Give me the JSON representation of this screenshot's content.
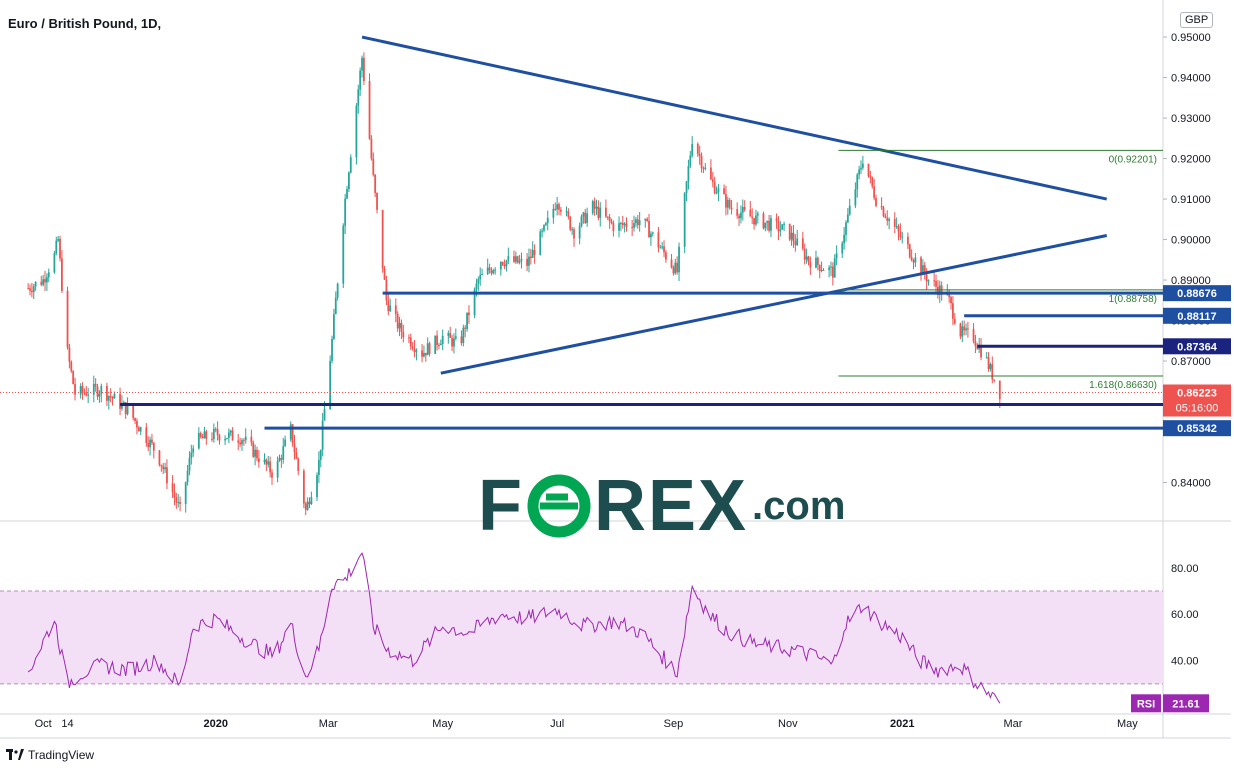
{
  "header": {
    "title": "Euro / British Pound, 1D,",
    "currency": "GBP"
  },
  "footer": {
    "brand": "TradingView"
  },
  "watermark": {
    "left": "F",
    "o": "O",
    "right": "REX",
    "suffix": ".com",
    "color": "#1d4d4f",
    "accent": "#00a651"
  },
  "colors": {
    "up": "#26a69a",
    "down": "#ef5350",
    "trendline": "#1e4fa1",
    "level_navy": "#1a237e",
    "fib": "#2e7d32",
    "rsi": "#9c27b0",
    "rsi_band": "#f3e0f7"
  },
  "chart_data": [
    {
      "type": "candlestick",
      "title": "Euro / British Pound, 1D,",
      "x_ticks": [
        "Oct",
        "14",
        "2020",
        "Mar",
        "May",
        "Jul",
        "Sep",
        "Nov",
        "2021",
        "Mar",
        "May"
      ],
      "y_ticks": [
        "0.95000",
        "0.94000",
        "0.93000",
        "0.92000",
        "0.91000",
        "0.90000",
        "0.89000",
        "0.88000",
        "0.87000",
        "0.84000"
      ],
      "ylim": [
        0.8305,
        0.951
      ],
      "price_path": [
        [
          "2019-09-23",
          0.888
        ],
        [
          "2019-10-01",
          0.89
        ],
        [
          "2019-10-07",
          0.896
        ],
        [
          "2019-10-09",
          0.9
        ],
        [
          "2019-10-14",
          0.872
        ],
        [
          "2019-10-18",
          0.862
        ],
        [
          "2019-11-01",
          0.863
        ],
        [
          "2019-11-15",
          0.858
        ],
        [
          "2019-12-01",
          0.847
        ],
        [
          "2019-12-13",
          0.833
        ],
        [
          "2019-12-20",
          0.85
        ],
        [
          "2020-01-01",
          0.852
        ],
        [
          "2020-01-15",
          0.851
        ],
        [
          "2020-02-01",
          0.842
        ],
        [
          "2020-02-10",
          0.853
        ],
        [
          "2020-02-18",
          0.833
        ],
        [
          "2020-02-25",
          0.845
        ],
        [
          "2020-03-03",
          0.875
        ],
        [
          "2020-03-10",
          0.91
        ],
        [
          "2020-03-19",
          0.945
        ],
        [
          "2020-03-25",
          0.915
        ],
        [
          "2020-04-01",
          0.885
        ],
        [
          "2020-04-08",
          0.878
        ],
        [
          "2020-04-20",
          0.872
        ],
        [
          "2020-05-01",
          0.876
        ],
        [
          "2020-05-10",
          0.874
        ],
        [
          "2020-05-20",
          0.89
        ],
        [
          "2020-06-01",
          0.895
        ],
        [
          "2020-06-15",
          0.894
        ],
        [
          "2020-06-25",
          0.903
        ],
        [
          "2020-07-01",
          0.91
        ],
        [
          "2020-07-10",
          0.902
        ],
        [
          "2020-07-20",
          0.908
        ],
        [
          "2020-08-01",
          0.903
        ],
        [
          "2020-08-15",
          0.905
        ],
        [
          "2020-08-28",
          0.896
        ],
        [
          "2020-09-03",
          0.892
        ],
        [
          "2020-09-07",
          0.91
        ],
        [
          "2020-09-11",
          0.925
        ],
        [
          "2020-09-20",
          0.915
        ],
        [
          "2020-10-01",
          0.908
        ],
        [
          "2020-10-15",
          0.905
        ],
        [
          "2020-11-01",
          0.902
        ],
        [
          "2020-11-12",
          0.895
        ],
        [
          "2020-11-25",
          0.892
        ],
        [
          "2020-12-01",
          0.902
        ],
        [
          "2020-12-11",
          0.92
        ],
        [
          "2020-12-18",
          0.91
        ],
        [
          "2021-01-01",
          0.9
        ],
        [
          "2021-01-08",
          0.895
        ],
        [
          "2021-01-15",
          0.89
        ],
        [
          "2021-01-25",
          0.886
        ],
        [
          "2021-02-01",
          0.877
        ],
        [
          "2021-02-08",
          0.876
        ],
        [
          "2021-02-15",
          0.87
        ],
        [
          "2021-02-22",
          0.8622
        ]
      ],
      "last_price": "0.86223",
      "countdown": "05:16:00",
      "trendlines": [
        {
          "from": [
            "2020-03-19",
            0.95
          ],
          "to": [
            "2021-04-20",
            0.91
          ]
        },
        {
          "from": [
            "2020-04-30",
            0.867
          ],
          "to": [
            "2021-04-20",
            0.901
          ]
        }
      ],
      "horizontal_levels": [
        {
          "price": 0.88676,
          "label": "0.88676",
          "from": "2020-03-30",
          "style": "trendline"
        },
        {
          "price": 0.88117,
          "label": "0.88117",
          "from": "2021-02-03",
          "style": "trendline"
        },
        {
          "price": 0.87364,
          "label": "0.87364",
          "from": "2021-02-10",
          "style": "level_navy"
        },
        {
          "price": 0.85927,
          "label": "0.85927",
          "from": "2019-11-11",
          "style": "level_navy"
        },
        {
          "price": 0.85342,
          "label": "0.85342",
          "from": "2020-01-27",
          "style": "trendline"
        }
      ],
      "fib_levels": [
        {
          "price": 0.92201,
          "label": "0(0.92201)"
        },
        {
          "price": 0.88758,
          "label": "1(0.88758)"
        },
        {
          "price": 0.8663,
          "label": "1.618(0.86630)"
        }
      ]
    },
    {
      "type": "line",
      "series": [
        {
          "name": "RSI",
          "x": [
            "2019-09-23",
            "2019-10-07",
            "2019-10-14",
            "2019-10-20",
            "2019-11-01",
            "2019-11-15",
            "2019-12-01",
            "2019-12-13",
            "2019-12-20",
            "2020-01-01",
            "2020-01-15",
            "2020-02-01",
            "2020-02-10",
            "2020-02-18",
            "2020-02-25",
            "2020-03-03",
            "2020-03-10",
            "2020-03-19",
            "2020-03-25",
            "2020-04-01",
            "2020-04-15",
            "2020-05-01",
            "2020-05-15",
            "2020-06-01",
            "2020-06-15",
            "2020-07-01",
            "2020-07-15",
            "2020-08-01",
            "2020-08-15",
            "2020-08-28",
            "2020-09-03",
            "2020-09-11",
            "2020-09-20",
            "2020-10-01",
            "2020-10-15",
            "2020-11-01",
            "2020-11-15",
            "2020-11-25",
            "2020-12-01",
            "2020-12-11",
            "2020-12-18",
            "2021-01-01",
            "2021-01-10",
            "2021-01-20",
            "2021-02-01",
            "2021-02-10",
            "2021-02-22"
          ],
          "values": [
            35,
            58,
            30,
            34,
            38,
            36,
            40,
            29,
            55,
            58,
            50,
            42,
            56,
            33,
            45,
            73,
            75,
            87,
            55,
            45,
            40,
            55,
            52,
            60,
            58,
            62,
            55,
            57,
            52,
            40,
            35,
            72,
            60,
            52,
            47,
            45,
            42,
            38,
            55,
            64,
            58,
            50,
            40,
            36,
            38,
            30,
            21.61
          ]
        }
      ],
      "y_ticks": [
        "80.00",
        "60.00",
        "40.00"
      ],
      "ylim": [
        17,
        92
      ],
      "band": [
        30,
        70
      ],
      "last_label": "RSI",
      "last_value": "21.61"
    }
  ]
}
